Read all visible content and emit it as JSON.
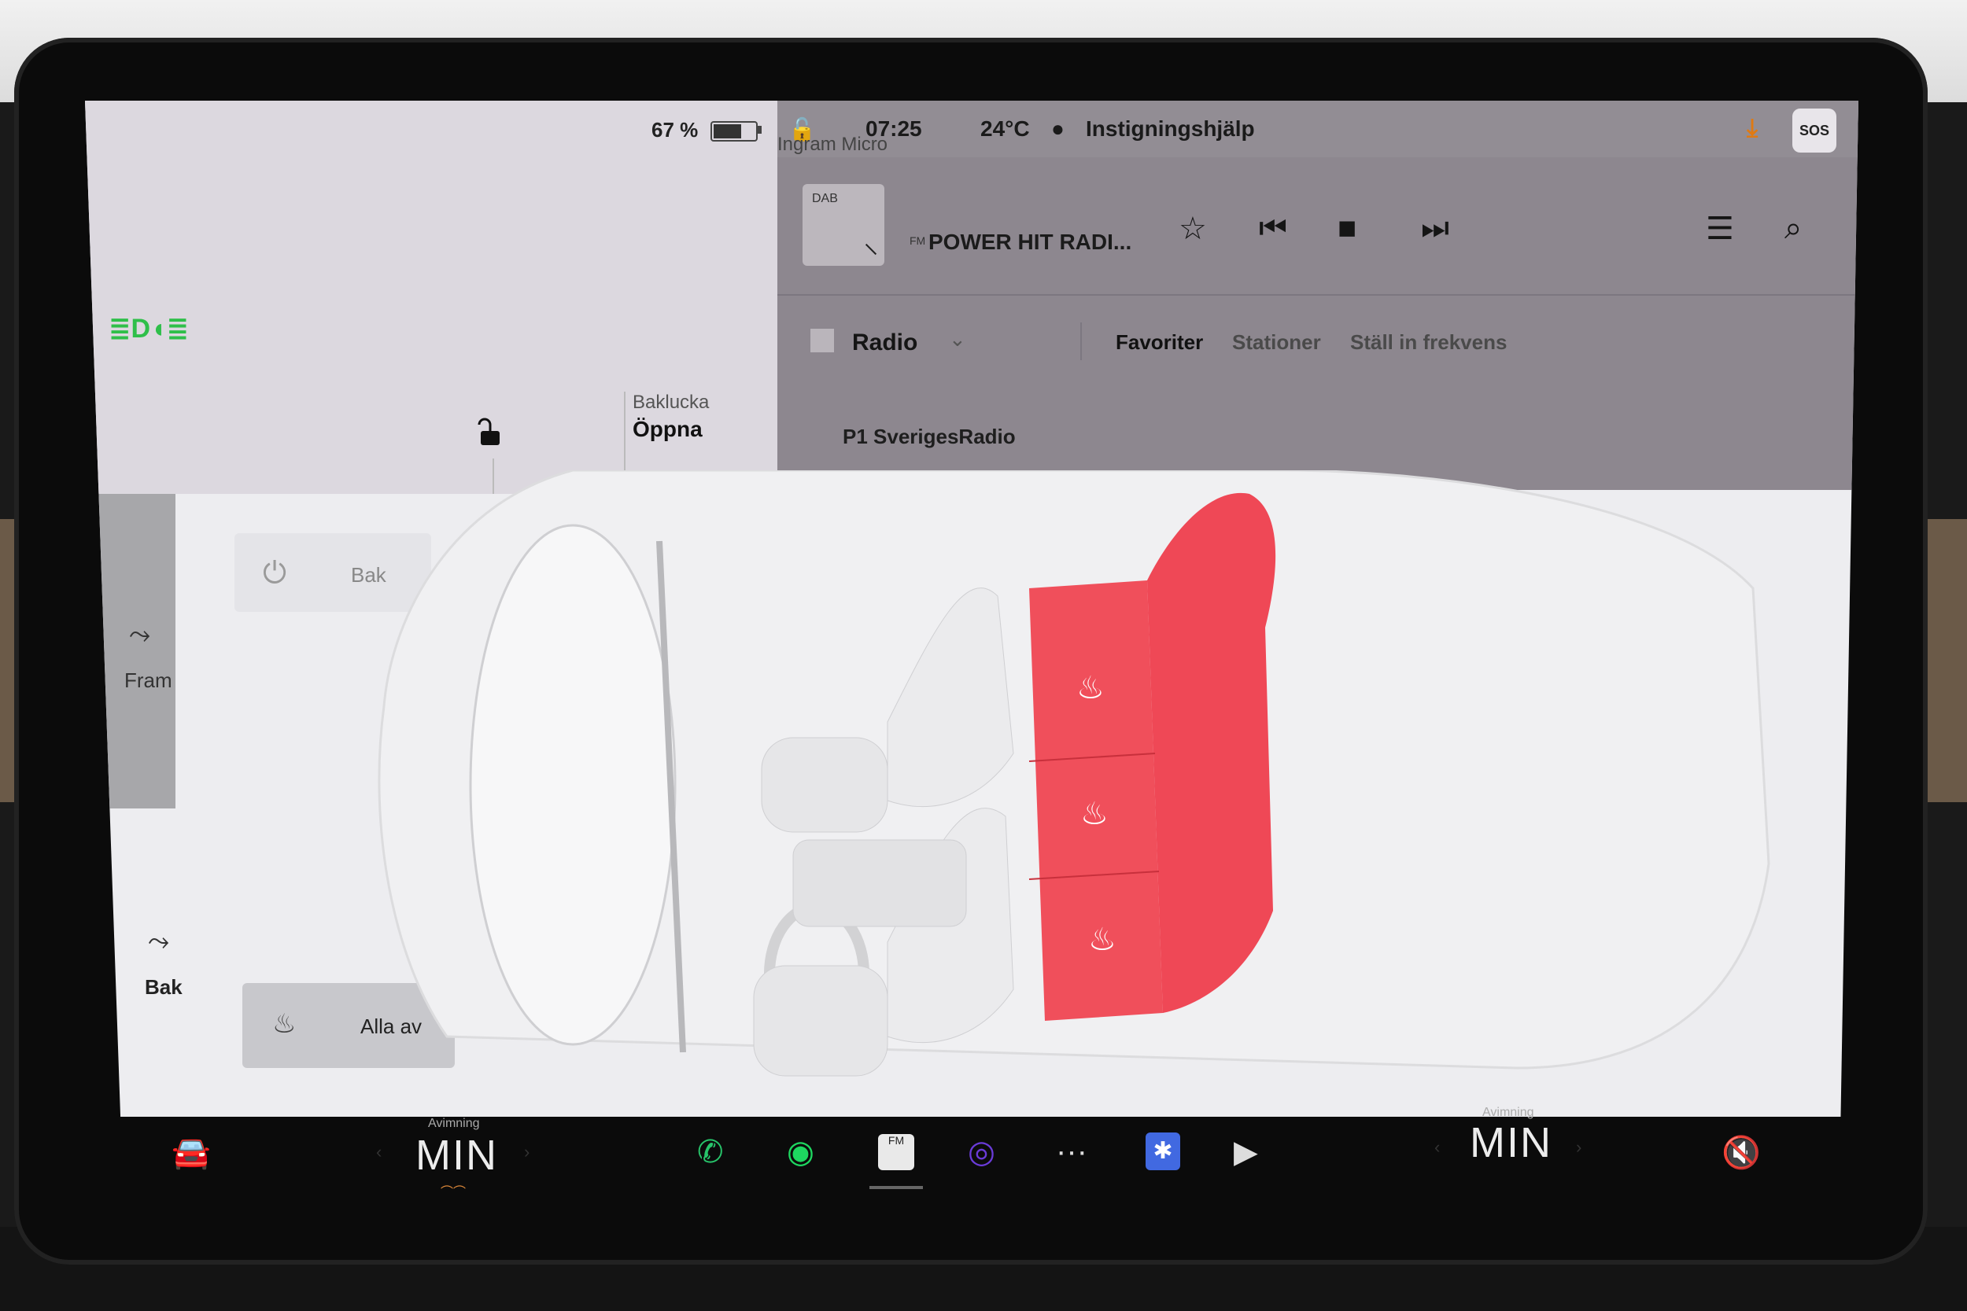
{
  "status": {
    "battery_percent": "67 %",
    "battery_level": 0.67,
    "time": "07:25",
    "temperature": "24°C",
    "profile": "Instigningshjälp",
    "overlay_text": "Ingram Micro",
    "sos_label": "SOS"
  },
  "car": {
    "trunk_label": "Baklucka",
    "trunk_action": "Öppna"
  },
  "media": {
    "art_label": "DAB",
    "station_icon": "FM",
    "station_name": "POWER HIT RADI...",
    "source_label": "Radio",
    "tabs": [
      "Favoriter",
      "Stationer",
      "Ställ in frekvens"
    ],
    "selected_station": "P1 SverigesRadio",
    "controls": [
      "star-icon",
      "previous-icon",
      "stop-icon",
      "next-icon",
      "queue-icon",
      "search-icon",
      "equalizer-icon"
    ]
  },
  "climate": {
    "fram_label": "Fram",
    "bak_side_label": "Bak",
    "power_button_label": "Bak",
    "all_off_label": "Alla av",
    "heated_zones": [
      "rear-left",
      "rear-middle",
      "rear-right"
    ],
    "heat_color": "#f0414e"
  },
  "dock": {
    "left_temp": {
      "sub": "Avimning",
      "value": "MIN"
    },
    "right_temp": {
      "sub": "Avimning",
      "value": "MIN"
    },
    "app_icons": [
      "car-icon",
      "phone-icon",
      "spotify-icon",
      "radio-icon",
      "camera-icon",
      "more-icon",
      "bluetooth-icon",
      "video-icon",
      "mute-icon"
    ]
  }
}
